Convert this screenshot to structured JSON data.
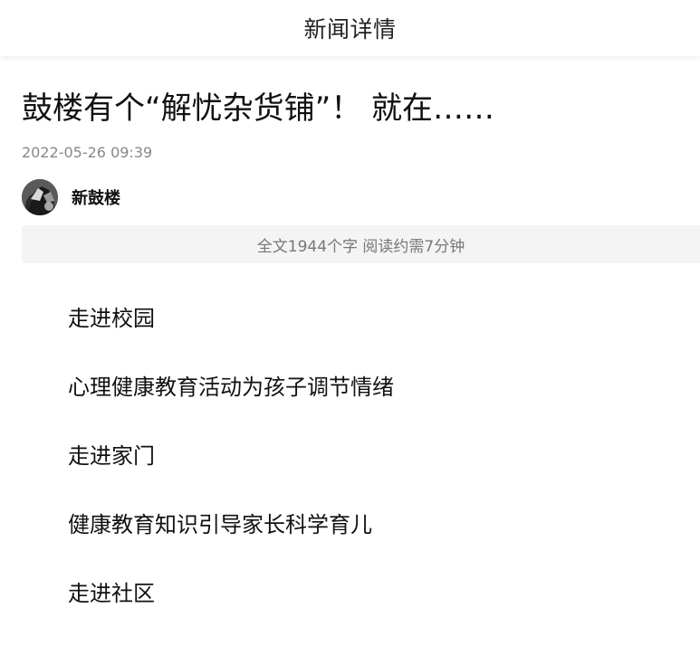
{
  "header": {
    "title": "新闻详情"
  },
  "article": {
    "title": "鼓楼有个“解忧杂货铺”！ 就在……",
    "publish_time": "2022-05-26 09:39",
    "author": {
      "name": "新鼓楼",
      "avatar_icon": "author-avatar"
    },
    "reading_info": "全文1944个字 阅读约需7分钟",
    "paragraphs": [
      "走进校园",
      "心理健康教育活动为孩子调节情绪",
      "走进家门",
      "健康教育知识引导家长科学育儿",
      "走进社区"
    ]
  }
}
